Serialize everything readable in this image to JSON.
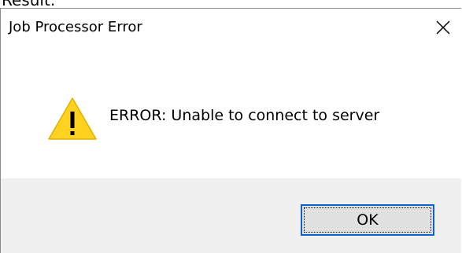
{
  "top_text": "Result:",
  "dialog": {
    "title": "Job Processor Error",
    "close_icon": "close-icon",
    "message": "ERROR: Unable to connect to server",
    "icon": "warning-icon",
    "ok_label": "OK"
  },
  "colors": {
    "warning_yellow": "#FFD21F",
    "footer_bg": "#F0F0F0",
    "button_border": "#0A64C8",
    "button_bg": "#E1E1E1"
  }
}
